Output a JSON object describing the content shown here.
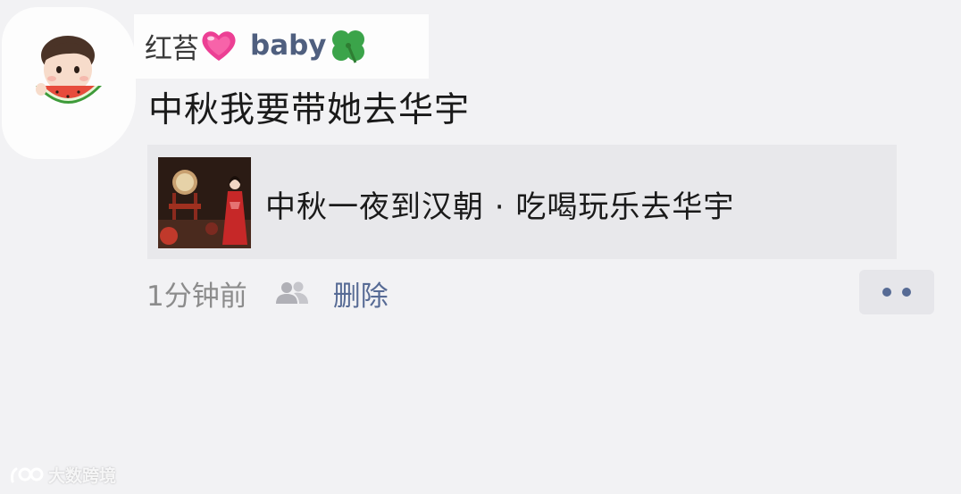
{
  "post": {
    "username_cn": "红苔",
    "username_en": "baby",
    "heart_emoji": "heart-emoji",
    "clover_emoji": "clover-emoji",
    "text": "中秋我要带她去华宇",
    "link": {
      "title": "中秋一夜到汉朝 · 吃喝玩乐去华宇"
    },
    "time": "1分钟前",
    "delete_label": "删除"
  },
  "watermark": {
    "text": "大数跨境"
  },
  "colors": {
    "link_blue": "#576b95",
    "card_bg": "#e8e8eb",
    "page_bg": "#f2f2f4"
  }
}
